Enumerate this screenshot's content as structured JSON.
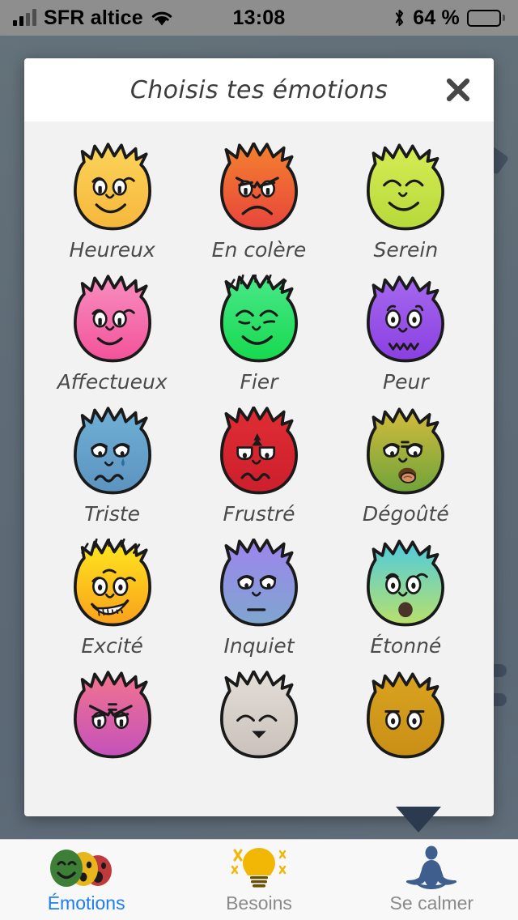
{
  "status_bar": {
    "carrier": "SFR altice",
    "wifi_icon": "wifi-icon",
    "signal_icon": "signal-bars-icon",
    "time": "13:08",
    "bluetooth_icon": "bluetooth-icon",
    "battery_percent": "64 %",
    "battery_icon": "battery-icon",
    "battery_level": 64
  },
  "modal": {
    "title": "Choisis tes émotions",
    "close_icon": "close-icon",
    "scroll_indicator_icon": "chevron-down-icon",
    "emotions": [
      {
        "label": "Heureux",
        "color_from": "#fcd45a",
        "color_to": "#f6b73c",
        "face": "happy"
      },
      {
        "label": "En colère",
        "color_from": "#f4822e",
        "color_to": "#e8453c",
        "face": "angry"
      },
      {
        "label": "Serein",
        "color_from": "#d6ec55",
        "color_to": "#b7d93a",
        "face": "calm"
      },
      {
        "label": "Affectueux",
        "color_from": "#f78fc0",
        "color_to": "#f3529a",
        "face": "loving"
      },
      {
        "label": "Fier",
        "color_from": "#4ae88a",
        "color_to": "#16d94e",
        "face": "proud"
      },
      {
        "label": "Peur",
        "color_from": "#a569ef",
        "color_to": "#8a3fe0",
        "face": "afraid"
      },
      {
        "label": "Triste",
        "color_from": "#6fb0d6",
        "color_to": "#5c93c0",
        "face": "sad"
      },
      {
        "label": "Frustré",
        "color_from": "#e02d34",
        "color_to": "#cc1f2c",
        "face": "frustrated"
      },
      {
        "label": "Dégoûté",
        "color_from": "#d4bc3c",
        "color_to": "#6fa33a",
        "face": "disgusted"
      },
      {
        "label": "Excité",
        "color_from": "#ffe81f",
        "color_to": "#f9a01b",
        "face": "excited"
      },
      {
        "label": "Inquiet",
        "color_from": "#9d84ee",
        "color_to": "#7fa6cf",
        "face": "worried"
      },
      {
        "label": "Étonné",
        "color_from": "#4ecbe0",
        "color_to": "#b9e06a",
        "face": "astonished"
      },
      {
        "label": "",
        "color_from": "#f2748e",
        "color_to": "#c451bb",
        "face": "partial-pink"
      },
      {
        "label": "",
        "color_from": "#e4ded8",
        "color_to": "#c9c1ba",
        "face": "partial-grey"
      },
      {
        "label": "",
        "color_from": "#d9a31f",
        "color_to": "#c98f16",
        "face": "partial-gold"
      }
    ]
  },
  "tab_bar": {
    "items": [
      {
        "label": "Émotions",
        "icon": "emotion-faces-icon",
        "active": true
      },
      {
        "label": "Besoins",
        "icon": "lightbulb-icon",
        "active": false
      },
      {
        "label": "Se calmer",
        "icon": "meditation-icon",
        "active": false
      }
    ],
    "active_color": "#1d7ef3",
    "inactive_color": "#8a8a8a"
  }
}
